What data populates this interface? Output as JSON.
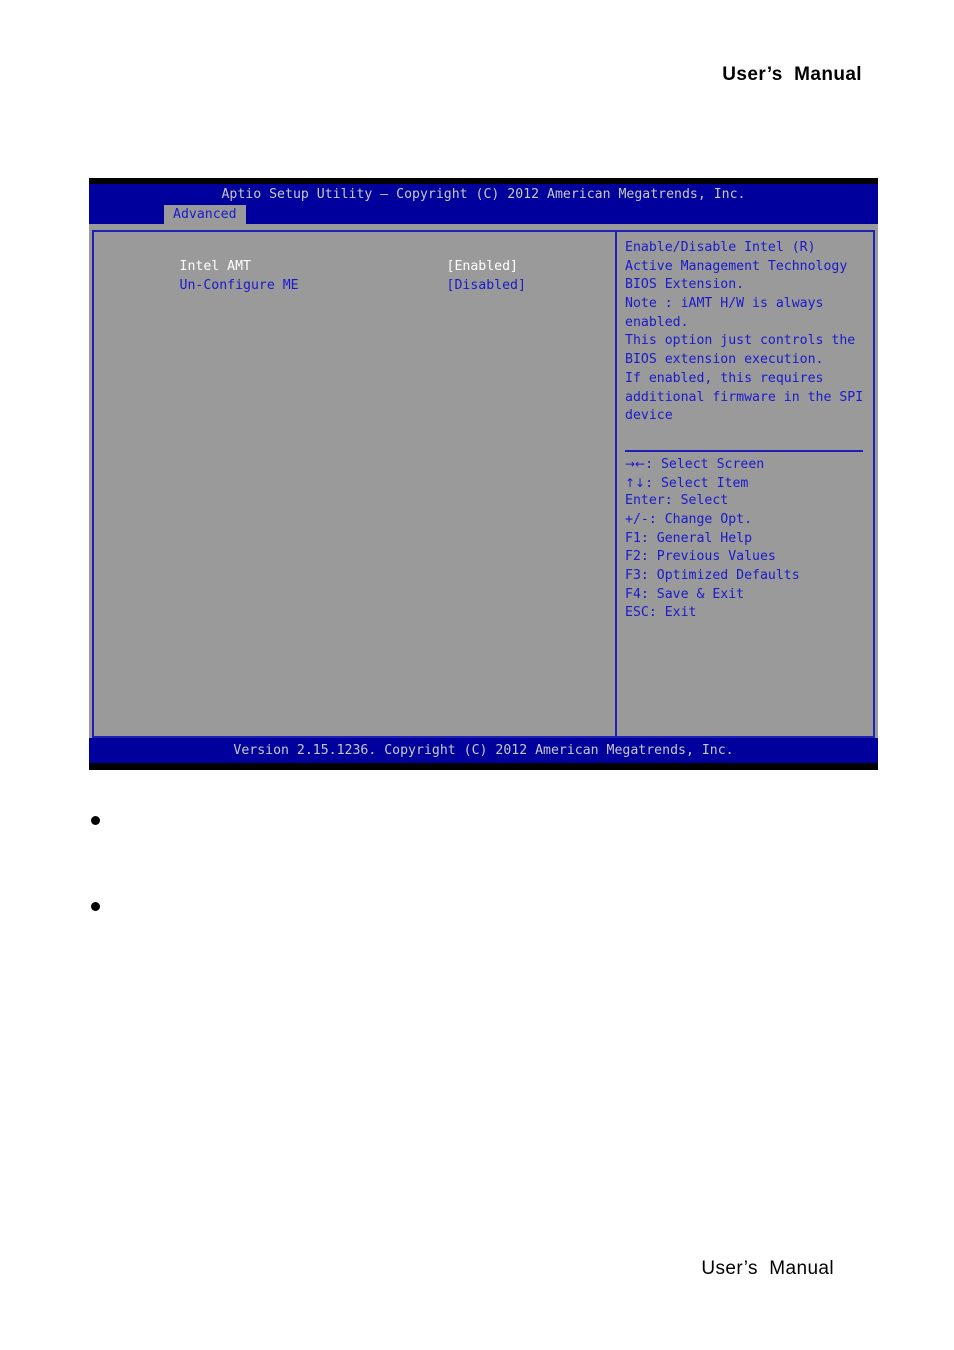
{
  "page": {
    "header_title": "User’s  Manual",
    "footer_title": "User’s  Manual"
  },
  "bios": {
    "title": "Aptio Setup Utility – Copyright (C) 2012 American Megatrends, Inc.",
    "active_tab": "Advanced",
    "version_bar": "Version 2.15.1236. Copyright (C) 2012 American Megatrends, Inc.",
    "options": [
      {
        "label": "Intel AMT",
        "value": "[Enabled]",
        "selected": true
      },
      {
        "label": "Un-Configure ME",
        "value": "[Disabled]",
        "selected": false
      }
    ],
    "help_lines": [
      "Enable/Disable Intel (R)",
      "Active Management Technology",
      "BIOS Extension.",
      "Note : iAMT H/W is always",
      "enabled.",
      "This option just controls the",
      "BIOS extension execution.",
      "If enabled, this requires",
      "additional firmware in the SPI",
      "device"
    ],
    "keys": [
      {
        "glyph": "→←",
        "text": ": Select Screen"
      },
      {
        "glyph": "↑↓",
        "text": ": Select Item"
      },
      {
        "glyph": "",
        "text": "Enter: Select"
      },
      {
        "glyph": "",
        "text": "+/-: Change Opt."
      },
      {
        "glyph": "",
        "text": "F1: General Help"
      },
      {
        "glyph": "",
        "text": "F2: Previous Values"
      },
      {
        "glyph": "",
        "text": "F3: Optimized Defaults"
      },
      {
        "glyph": "",
        "text": "F4: Save & Exit"
      },
      {
        "glyph": "",
        "text": "ESC: Exit"
      }
    ]
  },
  "bullets": [
    {
      "text": ""
    },
    {
      "text": ""
    }
  ],
  "colors": {
    "bios_background": "#9a9a9a",
    "bios_bar_blue": "#00009c",
    "bios_text_blue": "#1a1acc",
    "bios_border_blue": "#2020b4",
    "bios_text_selected": "#ffffff",
    "bios_bar_text": "#c8c8c8"
  }
}
